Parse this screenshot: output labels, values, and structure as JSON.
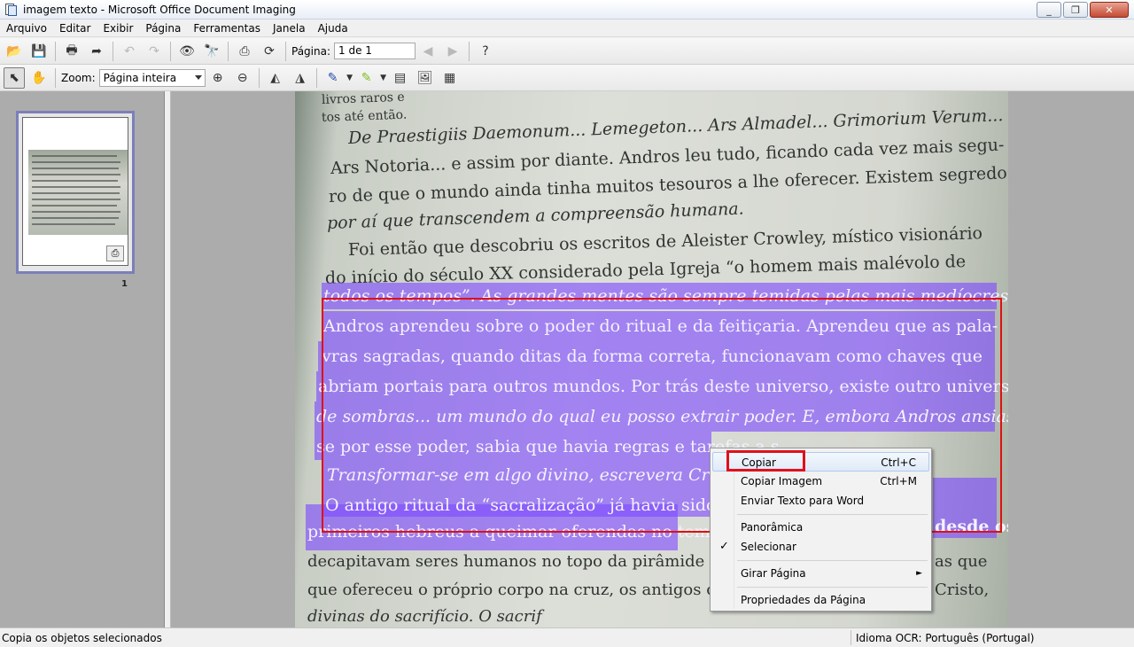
{
  "window": {
    "title": "imagem texto - Microsoft Office Document Imaging",
    "minimize": "▭",
    "restore": "❐",
    "close": "✕"
  },
  "menu": [
    "Arquivo",
    "Editar",
    "Exibir",
    "Página",
    "Ferramentas",
    "Janela",
    "Ajuda"
  ],
  "toolbar1": {
    "page_label": "Página:",
    "page_value": "1 de 1"
  },
  "toolbar2": {
    "zoom_label": "Zoom:",
    "zoom_value": "Página inteira"
  },
  "thumbnail": {
    "page_number": "1"
  },
  "document": {
    "lines_top": [
      "livros raros e",
      "tos até então.",
      "De Praestigiis Daemonum... Lemegeton... Ars Almadel... Grimorium Verum...",
      "Ars Notoria... e assim por diante. Andros leu tudo, ficando cada vez mais segu-",
      "ro de que o mundo ainda tinha muitos tesouros a lhe oferecer. Existem segredos",
      "por aí que transcendem a compreensão humana.",
      "Foi então que descobriu os escritos de Aleister Crowley, místico visionário",
      "do início do século XX considerado pela Igreja “o homem mais malévolo de"
    ],
    "lines_highlight": [
      "todos os tempos”. As grandes mentes são sempre temidas pelas mais medíocres.",
      "Andros aprendeu sobre o poder do ritual e da feitiçaria. Aprendeu que as pala-",
      "vras sagradas, quando ditas da forma correta, funcionavam como chaves que",
      "abriam portais para outros mundos. Por trás deste universo, existe outro universo",
      "de sombras... um mundo do qual eu posso extrair poder. E, embora Andros ansias-",
      "se por esse poder, sabia que havia regras e tarefas a s",
      "Transformar-se em algo divino, escrevera Crowle",
      "O antigo ritual da “sacralização” já havia sido un",
      "primeiros hebreus a queimar oferendas no templo"
    ],
    "lines_highlight_right": [
      "desde os"
    ],
    "lines_bottom": [
      "decapitavam seres humanos no topo da pirâmide de C",
      "que ofereceu o próprio corpo na cruz, os antigos compreendiam as exigên-",
      "divinas do sacrifício. O sacrif"
    ],
    "lines_bottom_right": [
      "as que",
      "Cristo,"
    ]
  },
  "context_menu": {
    "items": [
      {
        "label": "Copiar",
        "shortcut": "Ctrl+C"
      },
      {
        "label": "Copiar Imagem",
        "shortcut": "Ctrl+M"
      },
      {
        "label": "Enviar Texto para Word",
        "shortcut": ""
      },
      {
        "label": "Panorâmica",
        "shortcut": ""
      },
      {
        "label": "Selecionar",
        "shortcut": "",
        "checked": true
      },
      {
        "label": "Girar Página",
        "shortcut": "",
        "submenu": true
      },
      {
        "label": "Propriedades da Página",
        "shortcut": ""
      }
    ],
    "check_glyph": "✓",
    "submenu_glyph": "►"
  },
  "statusbar": {
    "left": "Copia os objetos selecionados",
    "right": "Idioma OCR: Português (Portugal)"
  },
  "colors": {
    "highlight": "#7e4aff",
    "selection_border": "#e01010",
    "callout_box": "#e0101c"
  }
}
